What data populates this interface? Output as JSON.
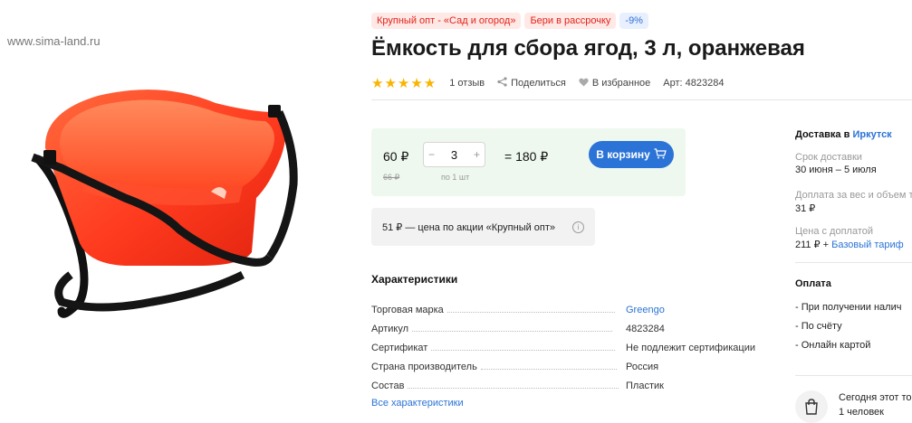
{
  "watermark": "www.sima-land.ru",
  "badges": [
    "Крупный опт - «Сад и огород»",
    "Бери в рассрочку",
    "-9%"
  ],
  "title": "Ёмкость для сбора ягод, 3 л, оранжевая",
  "rating": {
    "stars": "★★★★★",
    "value": 5,
    "reviews": "1 отзыв"
  },
  "share_label": "Поделиться",
  "favorite_label": "В избранное",
  "article": "Арт: 4823284",
  "buy": {
    "price": "60 ₽",
    "old_price": "66 ₽",
    "minus": "−",
    "qty": "3",
    "plus": "+",
    "per_unit": "по 1 шт",
    "total": "= 180 ₽",
    "cart_label": "В корзину"
  },
  "promo": {
    "text": "51 ₽ — цена по акции «Крупный опт»",
    "info_icon": "i"
  },
  "characteristics": {
    "title": "Характеристики",
    "rows": [
      {
        "key": "Торговая марка",
        "value": "Greengo"
      },
      {
        "key": "Артикул",
        "value": "4823284"
      },
      {
        "key": "Сертификат",
        "value": "Не подлежит сертификации"
      },
      {
        "key": "Страна производитель",
        "value": "Россия"
      },
      {
        "key": "Состав",
        "value": "Пластик"
      }
    ],
    "all_link": "Все характеристики"
  },
  "delivery": {
    "heading": "Доставка в",
    "city": "Иркутск",
    "term_label": "Срок доставки",
    "term_value": "30 июня – 5 июля",
    "surcharge_label": "Доплата за вес и объем то",
    "surcharge_value": "31 ₽",
    "price_label": "Цена с доплатой",
    "price_value": "211 ₽ +",
    "tariff_link": "Базовый тариф"
  },
  "payment": {
    "heading": "Оплата",
    "options": [
      "- При получении налич",
      "- По счёту",
      "- Онлайн картой"
    ]
  },
  "today": {
    "line1": "Сегодня этот то",
    "line2": "1 человек"
  },
  "colors": {
    "accent": "#2b73d6",
    "badge_red": "#e2231a",
    "panel_bg": "#eef8ee",
    "star": "#f8b500",
    "product_orange": "#ff3b1f"
  }
}
